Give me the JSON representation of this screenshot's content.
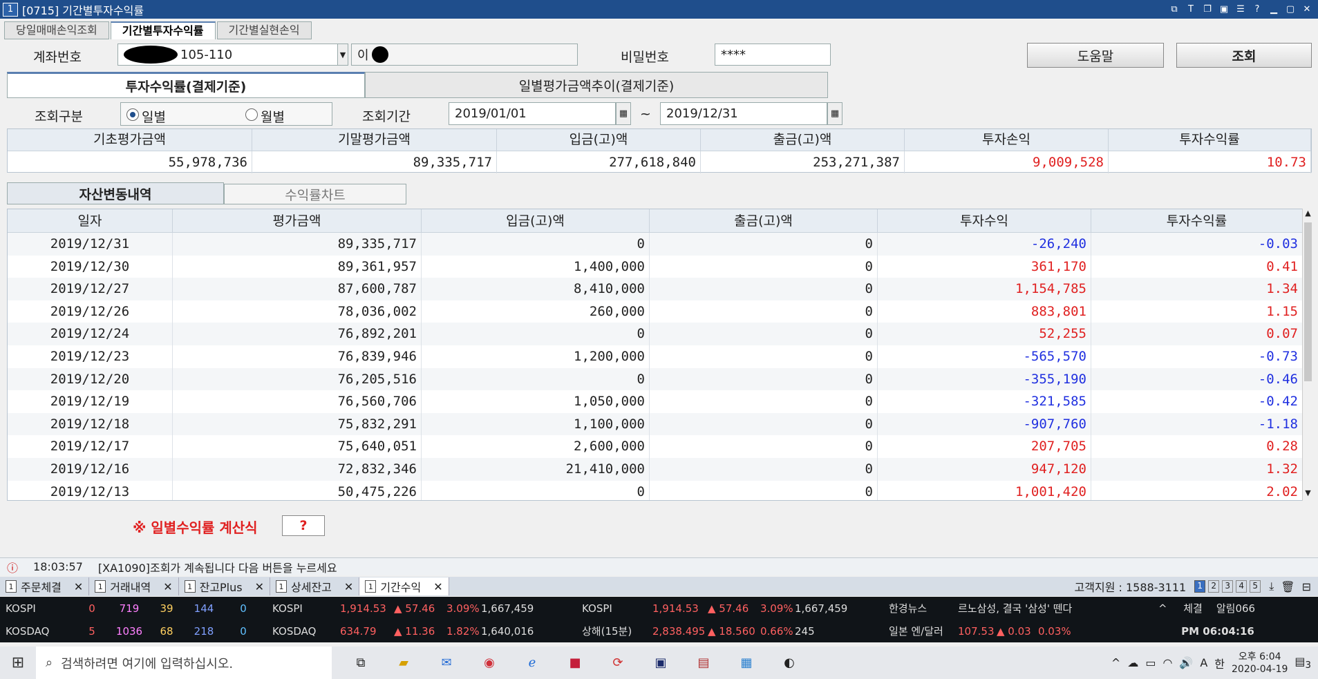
{
  "window": {
    "badge": "1",
    "title": "[0715] 기간별투자수익률"
  },
  "top_tabs": [
    "당일매매손익조회",
    "기간별투자수익률",
    "기간별실현손익"
  ],
  "form": {
    "account_label": "계좌번호",
    "account_value": "105-110",
    "owner_value": "이",
    "password_label": "비밀번호",
    "password_value": "****",
    "help_button": "도움말",
    "query_button": "조회"
  },
  "sub_tabs": [
    "투자수익률(결제기준)",
    "일별평가금액추이(결제기준)"
  ],
  "filter": {
    "type_label": "조회구분",
    "daily": "일별",
    "monthly": "월별",
    "period_label": "조회기간",
    "start": "2019/01/01",
    "tilde": "~",
    "end": "2019/12/31"
  },
  "summary": {
    "headers": [
      "기초평가금액",
      "기말평가금액",
      "입금(고)액",
      "출금(고)액",
      "투자손익",
      "투자수익률"
    ],
    "values": [
      "55,978,736",
      "89,335,717",
      "277,618,840",
      "253,271,387",
      "9,009,528",
      "10.73"
    ]
  },
  "section_tabs": [
    "자산변동내역",
    "수익률차트"
  ],
  "grid": {
    "headers": [
      "일자",
      "평가금액",
      "입금(고)액",
      "출금(고)액",
      "투자수익",
      "투자수익률"
    ],
    "rows": [
      [
        "2019/12/31",
        "89,335,717",
        "0",
        "0",
        "-26,240",
        "-0.03"
      ],
      [
        "2019/12/30",
        "89,361,957",
        "1,400,000",
        "0",
        "361,170",
        "0.41"
      ],
      [
        "2019/12/27",
        "87,600,787",
        "8,410,000",
        "0",
        "1,154,785",
        "1.34"
      ],
      [
        "2019/12/26",
        "78,036,002",
        "260,000",
        "0",
        "883,801",
        "1.15"
      ],
      [
        "2019/12/24",
        "76,892,201",
        "0",
        "0",
        "52,255",
        "0.07"
      ],
      [
        "2019/12/23",
        "76,839,946",
        "1,200,000",
        "0",
        "-565,570",
        "-0.73"
      ],
      [
        "2019/12/20",
        "76,205,516",
        "0",
        "0",
        "-355,190",
        "-0.46"
      ],
      [
        "2019/12/19",
        "76,560,706",
        "1,050,000",
        "0",
        "-321,585",
        "-0.42"
      ],
      [
        "2019/12/18",
        "75,832,291",
        "1,100,000",
        "0",
        "-907,760",
        "-1.18"
      ],
      [
        "2019/12/17",
        "75,640,051",
        "2,600,000",
        "0",
        "207,705",
        "0.28"
      ],
      [
        "2019/12/16",
        "72,832,346",
        "21,410,000",
        "0",
        "947,120",
        "1.32"
      ],
      [
        "2019/12/13",
        "50,475,226",
        "0",
        "0",
        "1,001,420",
        "2.02"
      ]
    ]
  },
  "formula": {
    "label": "※ 일별수익률 계산식",
    "button": "?"
  },
  "status": {
    "time": "18:03:57",
    "message": "[XA1090]조회가 계속됩니다 다음 버튼을 누르세요"
  },
  "bottom_tabs": [
    "주문체결",
    "거래내역",
    "잔고Plus",
    "상세잔고",
    "기간수익"
  ],
  "support": "고객지원 : 1588-3111",
  "page_nums": [
    "1",
    "2",
    "3",
    "4",
    "5"
  ],
  "ticker": {
    "kospi_label": "KOSPI",
    "kospi_counts": [
      "0",
      "719",
      "39",
      "144",
      "0"
    ],
    "kosdaq_label": "KOSDAQ",
    "kosdaq_counts": [
      "5",
      "1036",
      "68",
      "218",
      "0"
    ],
    "m1_kospi": [
      "KOSPI",
      "1,914.53",
      "▲ 57.46",
      "3.09%",
      "1,667,459"
    ],
    "m1_kosdaq": [
      "KOSDAQ",
      "634.79",
      "▲ 11.36",
      "1.82%",
      "1,640,016"
    ],
    "m2_kospi": [
      "KOSPI",
      "1,914.53",
      "▲ 57.46",
      "3.09%",
      "1,667,459"
    ],
    "m2_sh": [
      "상해(15분)",
      "2,838.495",
      "▲ 18.560",
      "0.66%",
      "245"
    ],
    "news_label": "한경뉴스",
    "news_text": "르노삼성, 결국 '삼성' 뗀다",
    "fx_label": "일본 엔/달러",
    "fx": [
      "107.53",
      "▲ 0.03",
      "0.03%"
    ],
    "right1": "체결",
    "right2": "알림066",
    "clock": "PM 06:04:16"
  },
  "taskbar": {
    "search_placeholder": "검색하려면 여기에 입력하십시오.",
    "time": "오후 6:04",
    "date": "2020-04-19",
    "lang": "한",
    "ime": "A",
    "notif": "3"
  },
  "colors": {
    "title": "#1f4e8c",
    "positive": "#e02020",
    "negative": "#2030e0"
  }
}
